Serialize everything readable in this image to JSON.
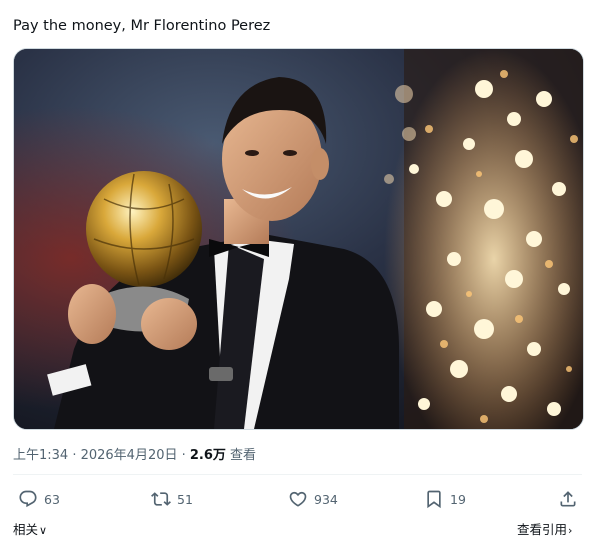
{
  "post": {
    "text": "Pay the money, Mr Florentino Perez"
  },
  "meta": {
    "timestamp": "上午1:34 · 2026年4月20日 · ",
    "views_count": "2.6万",
    "views_label": " 查看"
  },
  "actions": {
    "replies": "63",
    "reposts": "51",
    "likes": "934",
    "bookmarks": "19"
  },
  "footer": {
    "related_label": "相关",
    "quotes_label": "查看引用"
  },
  "colors": {
    "text": "#0f1419",
    "muted": "#536471",
    "border": "#cfd9de",
    "divider": "#eff3f4"
  },
  "icons": {
    "reply": "speech-bubble-icon",
    "repost": "repost-arrows-icon",
    "like": "heart-icon",
    "bookmark": "bookmark-icon",
    "share": "share-upload-icon",
    "related": "chevron-down-icon"
  }
}
